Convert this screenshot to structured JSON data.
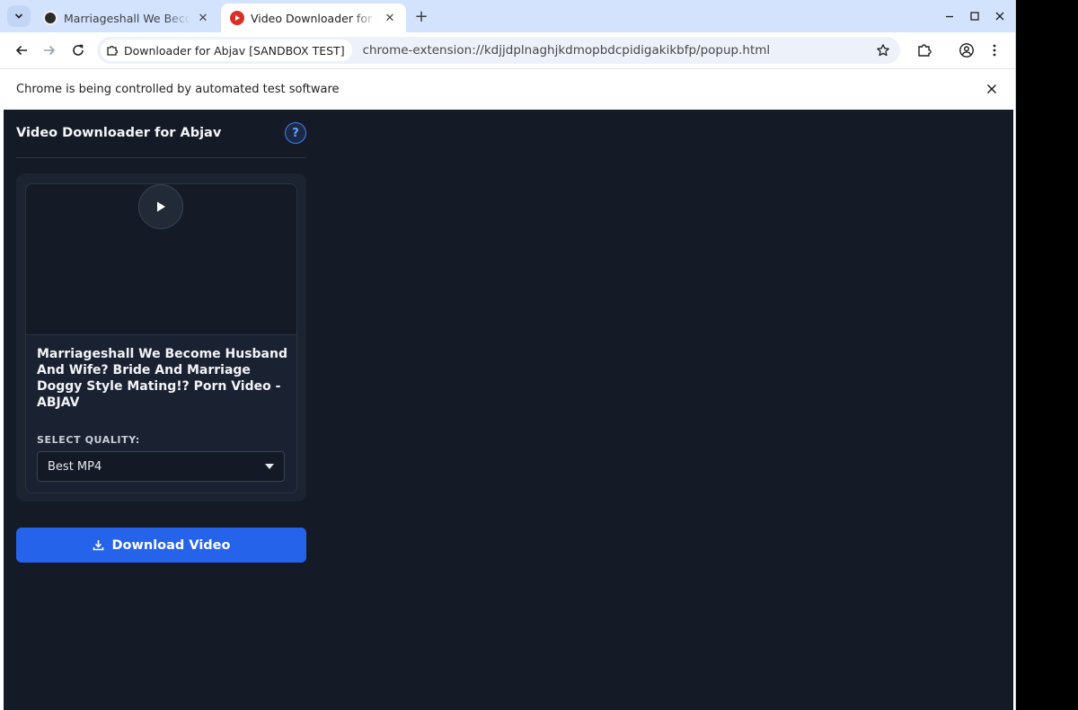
{
  "browser": {
    "tabs": [
      {
        "title": "Marriageshall We Become Husband And Wife? Bride And Marriage",
        "active": false
      },
      {
        "title": "Video Downloader for Abjav",
        "active": true
      }
    ],
    "new_tab_label": "+",
    "address": {
      "chip_label": "Downloader for Abjav [SANDBOX TEST]",
      "url": "chrome-extension://kdjjdplnaghjkdmopbdcpidigakikbfp/popup.html"
    },
    "infobar_message": "Chrome is being controlled by automated test software"
  },
  "popup": {
    "title": "Video Downloader for Abjav",
    "help_label": "?",
    "video": {
      "title": "Marriageshall We Become Husband And Wife? Bride And Marriage Doggy Style Mating!? Porn Video - ABJAV"
    },
    "quality": {
      "label": "SELECT QUALITY:",
      "selected": "Best MP4"
    },
    "download_label": "Download Video"
  },
  "colors": {
    "page_bg": "#151b26",
    "accent": "#2563eb",
    "tabstrip": "#d3e3fd"
  }
}
